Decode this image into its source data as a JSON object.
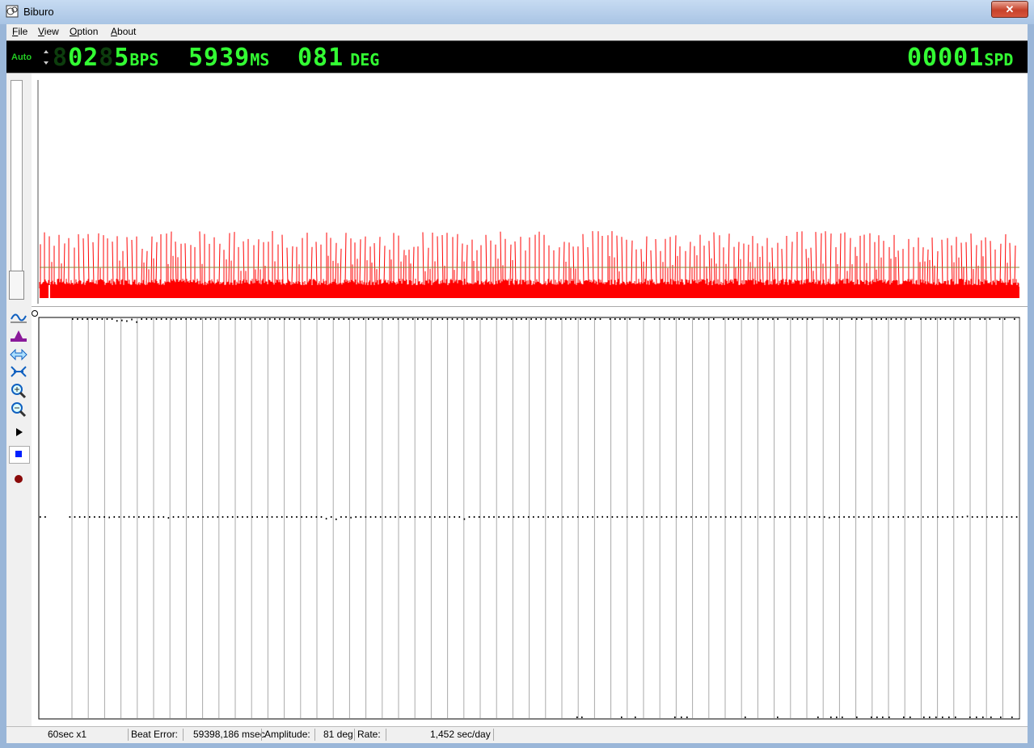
{
  "window": {
    "title": "Biburo",
    "close_label": "✕"
  },
  "menu": [
    {
      "label": "File",
      "accel": "F",
      "rest": "ile"
    },
    {
      "label": "View",
      "accel": "V",
      "rest": "iew"
    },
    {
      "label": "Option",
      "accel": "O",
      "rest": "ption"
    },
    {
      "label": "About",
      "accel": "A",
      "rest": "bout"
    }
  ],
  "display": {
    "mode": "Auto",
    "bps_value": "02",
    "bps_digit2": "5",
    "bps_unit": "BPS",
    "ms_value": "5939",
    "ms_unit": "MS",
    "deg_value": "081",
    "deg_unit": "DEG",
    "spd_value": "00001",
    "spd_unit": "SPD",
    "color": "#33ff33"
  },
  "waveform": {
    "color": "#ff0000",
    "threshold_color": "#8a8a3a"
  },
  "toolbar": {
    "icons": [
      "waveform-icon",
      "threshold-icon",
      "expand-horizontal-icon",
      "compress-icon",
      "zoom-in-icon",
      "zoom-out-icon",
      "play-icon",
      "stop-icon",
      "record-icon"
    ]
  },
  "status": {
    "timebase": "60sec x1",
    "beat_error_label": "Beat Error:",
    "beat_error_value": "59398,186 msec",
    "amplitude_label": "Amplitude:",
    "amplitude_value": "81 deg",
    "rate_label": "Rate:",
    "rate_value": "1,452 sec/day"
  }
}
